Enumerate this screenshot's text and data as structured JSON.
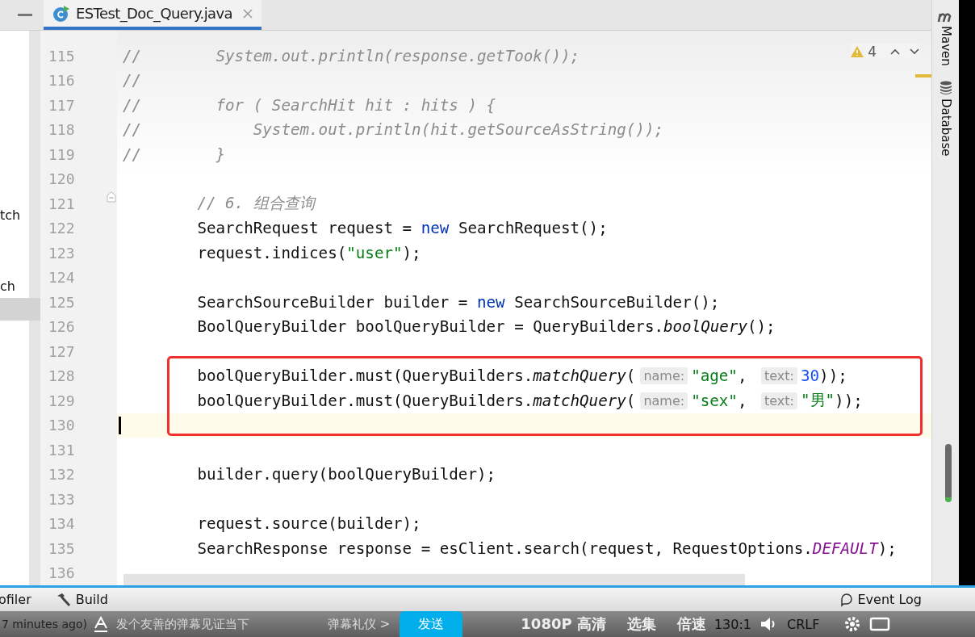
{
  "tab": {
    "title": "ESTest_Doc_Query.java",
    "selected": true
  },
  "side_panel": {
    "items": [
      {
        "label": "tch",
        "selected": false
      },
      {
        "label": "ch",
        "selected": false
      }
    ]
  },
  "editor": {
    "warnings": "4",
    "lines": [
      {
        "number": "115",
        "tokens": [
          {
            "kind": "comment",
            "text": "//        System.out.println(response.getTook());"
          }
        ]
      },
      {
        "number": "116",
        "tokens": [
          {
            "kind": "comment",
            "text": "//"
          }
        ]
      },
      {
        "number": "117",
        "tokens": [
          {
            "kind": "comment",
            "text": "//        for ( SearchHit hit : hits ) {"
          }
        ]
      },
      {
        "number": "118",
        "tokens": [
          {
            "kind": "comment",
            "text": "//            System.out.println(hit.getSourceAsString());"
          }
        ]
      },
      {
        "number": "119",
        "tokens": [
          {
            "kind": "comment",
            "text": "//        }"
          }
        ]
      },
      {
        "number": "120"
      },
      {
        "number": "121",
        "fold": true,
        "tokens": [
          {
            "kind": "comment",
            "text": "        // 6. 组合查询"
          }
        ]
      },
      {
        "number": "122",
        "tokens": [
          {
            "kind": "plain",
            "text": "        SearchRequest request = "
          },
          {
            "kind": "keyword",
            "text": "new"
          },
          {
            "kind": "plain",
            "text": " SearchRequest();"
          }
        ]
      },
      {
        "number": "123",
        "tokens": [
          {
            "kind": "plain",
            "text": "        request.indices("
          },
          {
            "kind": "string",
            "text": "\"user\""
          },
          {
            "kind": "plain",
            "text": ");"
          }
        ]
      },
      {
        "number": "124"
      },
      {
        "number": "125",
        "tokens": [
          {
            "kind": "plain",
            "text": "        SearchSourceBuilder builder = "
          },
          {
            "kind": "keyword",
            "text": "new"
          },
          {
            "kind": "plain",
            "text": " SearchSourceBuilder();"
          }
        ]
      },
      {
        "number": "126",
        "tokens": [
          {
            "kind": "plain",
            "text": "        BoolQueryBuilder boolQueryBuilder = QueryBuilders."
          },
          {
            "kind": "method",
            "text": "boolQuery"
          },
          {
            "kind": "plain",
            "text": "();"
          }
        ]
      },
      {
        "number": "127"
      },
      {
        "number": "128",
        "tokens": [
          {
            "kind": "plain",
            "text": "        boolQueryBuilder.must(QueryBuilders."
          },
          {
            "kind": "method",
            "text": "matchQuery"
          },
          {
            "kind": "plain",
            "text": "("
          },
          {
            "kind": "hint",
            "text": "name:"
          },
          {
            "kind": "string",
            "text": "\"age\""
          },
          {
            "kind": "plain",
            "text": ", "
          },
          {
            "kind": "hint",
            "text": "text:"
          },
          {
            "kind": "number",
            "text": "30"
          },
          {
            "kind": "plain",
            "text": "));"
          }
        ]
      },
      {
        "number": "129",
        "tokens": [
          {
            "kind": "plain",
            "text": "        boolQueryBuilder.must(QueryBuilders."
          },
          {
            "kind": "method",
            "text": "matchQuery"
          },
          {
            "kind": "plain",
            "text": "("
          },
          {
            "kind": "hint",
            "text": "name:"
          },
          {
            "kind": "string",
            "text": "\"sex\""
          },
          {
            "kind": "plain",
            "text": ", "
          },
          {
            "kind": "hint",
            "text": "text:"
          },
          {
            "kind": "string",
            "text": "\"男\""
          },
          {
            "kind": "plain",
            "text": "));"
          }
        ]
      },
      {
        "number": "130",
        "current": true
      },
      {
        "number": "131"
      },
      {
        "number": "132",
        "tokens": [
          {
            "kind": "plain",
            "text": "        builder.query(boolQueryBuilder);"
          }
        ]
      },
      {
        "number": "133"
      },
      {
        "number": "134",
        "tokens": [
          {
            "kind": "plain",
            "text": "        request.source(builder);"
          }
        ]
      },
      {
        "number": "135",
        "tokens": [
          {
            "kind": "plain",
            "text": "        SearchResponse response = esClient.search(request, RequestOptions."
          },
          {
            "kind": "static",
            "text": "DEFAULT"
          },
          {
            "kind": "plain",
            "text": ");"
          }
        ]
      },
      {
        "number": "136"
      }
    ]
  },
  "tool_stripe": [
    {
      "kind": "maven",
      "label": "Maven"
    },
    {
      "kind": "database",
      "label": "Database"
    }
  ],
  "tool_bar": {
    "items": [
      {
        "label": "ofiler"
      },
      {
        "kind": "build",
        "label": "Build"
      }
    ],
    "event_log": "Event Log"
  },
  "video_bar": {
    "status": "7 minutes ago)",
    "placeholder": "发个友善的弹幕见证当下",
    "etiquette": "弹幕礼仪 >",
    "send": "发送",
    "quality": "1080P 高清",
    "episodes": "选集",
    "speed": "倍速",
    "position": "130:1",
    "line_ending": "CRLF"
  }
}
